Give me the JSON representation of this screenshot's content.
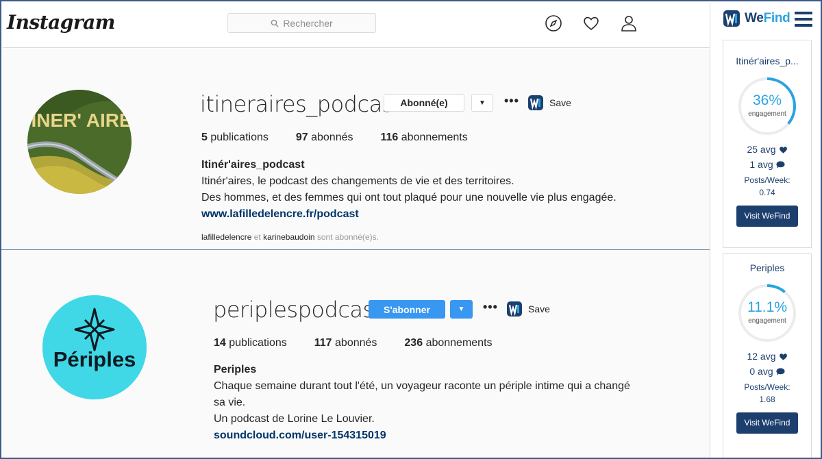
{
  "header": {
    "logo": "Instagram",
    "search_placeholder": "Rechercher"
  },
  "profiles": [
    {
      "username": "itineraires_podcast",
      "follow_state_label": "Abonné(e)",
      "save_label": "Save",
      "stats": {
        "posts_count": "5",
        "posts_label": "publications",
        "followers_count": "97",
        "followers_label": "abonnés",
        "following_count": "116",
        "following_label": "abonnements"
      },
      "bio_name": "Itinér'aires_podcast",
      "bio_lines": [
        "Itinér'aires, le podcast des changements de vie et des territoires.",
        "Des hommes, et des femmes qui ont tout plaqué pour une nouvelle vie plus engagée."
      ],
      "bio_link": "www.lafilledelencre.fr/podcast",
      "followed_by": {
        "user1": "lafilledelencre",
        "and": "et",
        "user2": "karinebaudoin",
        "suffix": "sont abonné(e)s."
      },
      "avatar_text": "ITINER' AIRES"
    },
    {
      "username": "periplespodcast",
      "follow_state_label": "S'abonner",
      "save_label": "Save",
      "stats": {
        "posts_count": "14",
        "posts_label": "publications",
        "followers_count": "117",
        "followers_label": "abonnés",
        "following_count": "236",
        "following_label": "abonnements"
      },
      "bio_name": "Periples",
      "bio_lines": [
        "Chaque semaine durant tout l'été, un voyageur raconte un périple intime qui a changé sa vie.",
        "Un podcast de Lorine Le Louvier."
      ],
      "bio_link": "soundcloud.com/user-154315019",
      "avatar_text": "Périples"
    }
  ],
  "wefind": {
    "brand_we": "We",
    "brand_find": "Find",
    "cards": [
      {
        "title": "Itinér'aires_p...",
        "engagement_pct": "36%",
        "engagement_fraction": 0.36,
        "engagement_label": "engagement",
        "likes_avg": "25 avg",
        "comments_avg": "1 avg",
        "posts_week_label": "Posts/Week:",
        "posts_week": "0.74",
        "button": "Visit WeFind"
      },
      {
        "title": "Periples",
        "engagement_pct": "11.1%",
        "engagement_fraction": 0.111,
        "engagement_label": "engagement",
        "likes_avg": "12 avg",
        "comments_avg": "0 avg",
        "posts_week_label": "Posts/Week:",
        "posts_week": "1.68",
        "button": "Visit WeFind"
      }
    ]
  },
  "colors": {
    "accent_blue": "#3897f0",
    "wefind_navy": "#1c3f6e",
    "wefind_cyan": "#2aa4e0",
    "periples_teal": "#40d8e6"
  }
}
